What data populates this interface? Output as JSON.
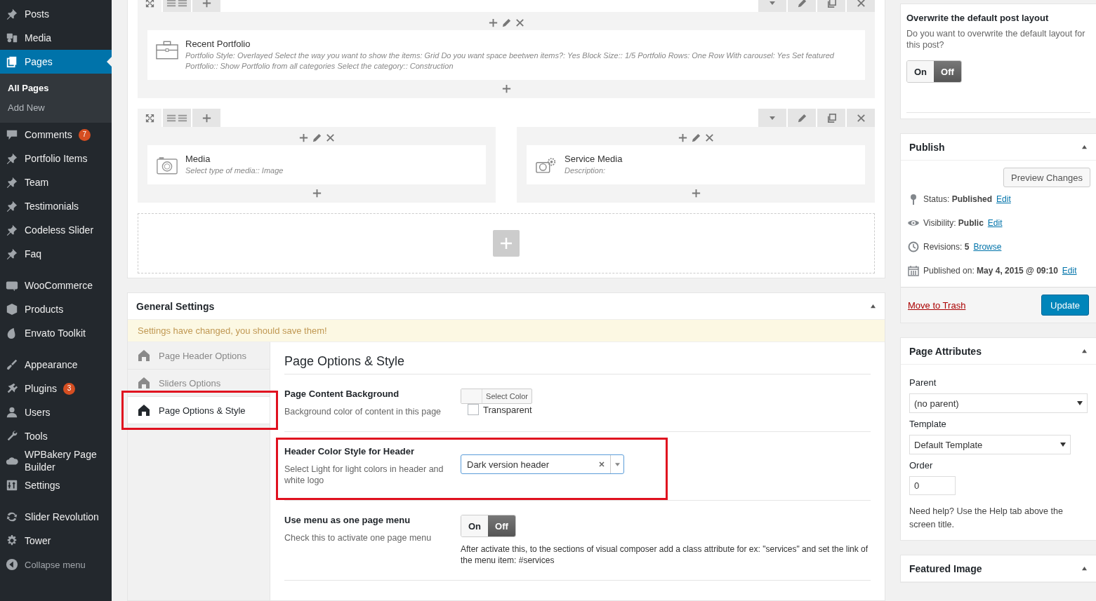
{
  "sidebar": {
    "groups": [
      {
        "items": [
          {
            "label": "Posts",
            "selected": false
          },
          {
            "label": "Media",
            "selected": false
          },
          {
            "label": "Pages",
            "selected": true,
            "children": [
              {
                "label": "All Pages",
                "selected": true
              },
              {
                "label": "Add New",
                "selected": false
              }
            ]
          },
          {
            "label": "Comments",
            "selected": false,
            "badge": "7"
          },
          {
            "label": "Portfolio Items",
            "selected": false
          },
          {
            "label": "Team",
            "selected": false
          },
          {
            "label": "Testimonials",
            "selected": false
          },
          {
            "label": "Codeless Slider",
            "selected": false
          },
          {
            "label": "Faq",
            "selected": false
          }
        ]
      },
      {
        "items": [
          {
            "label": "WooCommerce",
            "selected": false
          },
          {
            "label": "Products",
            "selected": false
          },
          {
            "label": "Envato Toolkit",
            "selected": false
          }
        ]
      },
      {
        "items": [
          {
            "label": "Appearance",
            "selected": false
          },
          {
            "label": "Plugins",
            "selected": false,
            "badge": "3"
          },
          {
            "label": "Users",
            "selected": false
          },
          {
            "label": "Tools",
            "selected": false
          },
          {
            "label": "WPBakery Page Builder",
            "selected": false
          },
          {
            "label": "Settings",
            "selected": false
          }
        ]
      },
      {
        "items": [
          {
            "label": "Slider Revolution",
            "selected": false
          },
          {
            "label": "Tower",
            "selected": false
          }
        ]
      }
    ],
    "collapse": "Collapse menu"
  },
  "builder": {
    "rows": [
      {
        "columns": [
          {
            "elements": [
              {
                "title": "Recent Portfolio",
                "description": "Portfolio Style: Overlayed  Select the way you want to show the items: Grid  Do you want space beetwen items?: Yes  Block Size:: 1/5  Portfolio Rows: One Row  With carousel: Yes  Set featured Portfolio:: Show Portfolio from all categories  Select the category:: Construction"
              }
            ]
          }
        ]
      },
      {
        "columns": [
          {
            "elements": [
              {
                "title": "Media",
                "description": "Select type of media:: Image"
              }
            ]
          },
          {
            "elements": [
              {
                "title": "Service Media",
                "description": "Description:"
              }
            ]
          }
        ]
      }
    ]
  },
  "general_settings": {
    "title": "General Settings",
    "notice": "Settings have changed, you should save them!",
    "tabs": [
      {
        "label": "Page Header Options",
        "selected": false,
        "highlighted": false
      },
      {
        "label": "Sliders Options",
        "selected": false,
        "highlighted": false
      },
      {
        "label": "Page Options & Style",
        "selected": true,
        "highlighted": true
      }
    ],
    "section_title": "Page Options & Style",
    "settings": [
      {
        "kind": "color",
        "label": "Page Content Background",
        "description": "Background color of content in this page",
        "button": "Select Color",
        "checkbox_label": "Transparent",
        "checked": false,
        "highlighted": false
      },
      {
        "kind": "select",
        "label": "Header Color Style for Header",
        "description": "Select Light for light colors in header and white logo",
        "value": "Dark version header",
        "highlighted": true
      },
      {
        "kind": "switch",
        "label": "Use menu as one page menu",
        "description": "Check this to activate one page menu",
        "on_label": "On",
        "off_label": "Off",
        "on": false,
        "note": "After activate this, to the sections of visual composer add a class attribute for ex: \"services\" and set the link of the menu item: #services",
        "highlighted": false
      }
    ]
  },
  "layout_box": {
    "title": "Overwrite the default post layout",
    "description": "Do you want to overwrite the default layout for this post?",
    "on_label": "On",
    "off_label": "Off",
    "on": false
  },
  "publish": {
    "title": "Publish",
    "preview_button": "Preview Changes",
    "lines": [
      {
        "text": "Status: **Published**",
        "link": "Edit"
      },
      {
        "text": "Visibility: **Public**",
        "link": "Edit"
      },
      {
        "text": "Revisions: **5**",
        "link": "Browse"
      },
      {
        "text": "Published on: **May 4, 2015 @ 09:10**",
        "link": "Edit"
      }
    ],
    "trash_link": "Move to Trash",
    "update_button": "Update"
  },
  "page_attributes": {
    "title": "Page Attributes",
    "fields": [
      {
        "kind": "select",
        "label": "Parent",
        "value": "(no parent)"
      },
      {
        "kind": "select",
        "label": "Template",
        "value": "Default Template"
      },
      {
        "kind": "input",
        "label": "Order",
        "value": "0"
      }
    ],
    "help": "Need help? Use the Help tab above the screen title."
  },
  "featured_image": {
    "title": "Featured Image"
  }
}
